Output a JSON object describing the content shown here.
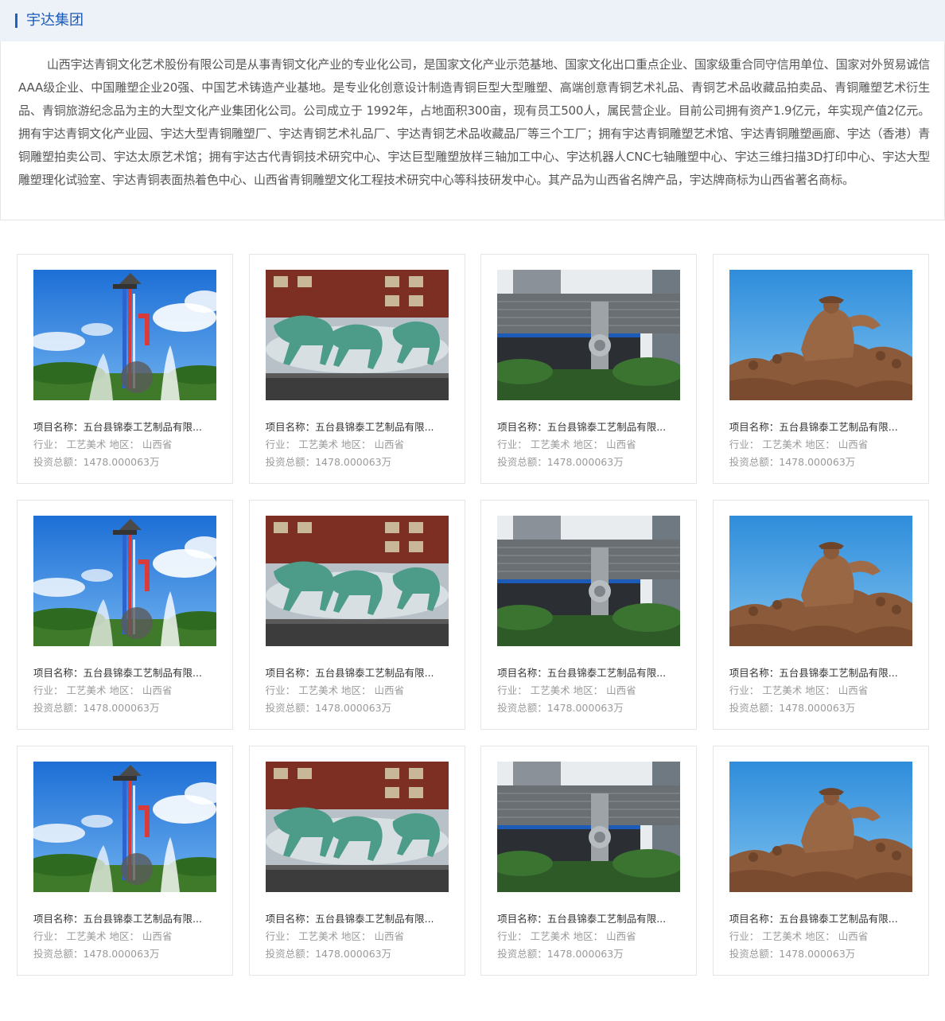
{
  "header": {
    "title": "宇达集团"
  },
  "intro": {
    "text": "山西宇达青铜文化艺术股份有限公司是从事青铜文化产业的专业化公司，是国家文化产业示范基地、国家文化出口重点企业、国家级重合同守信用单位、国家对外贸易诚信AAA级企业、中国雕塑企业20强、中国艺术铸造产业基地。是专业化创意设计制造青铜巨型大型雕塑、高端创意青铜艺术礼品、青铜艺术品收藏品拍卖品、青铜雕塑艺术衍生品、青铜旅游纪念品为主的大型文化产业集团化公司。公司成立于 1992年，占地面积300亩，现有员工500人，属民营企业。目前公司拥有资产1.9亿元，年实现产值2亿元。拥有宇达青铜文化产业园、宇达大型青铜雕塑厂、宇达青铜艺术礼品厂、宇达青铜艺术品收藏品厂等三个工厂；拥有宇达青铜雕塑艺术馆、宇达青铜雕塑画廊、宇达（香港）青铜雕塑拍卖公司、宇达太原艺术馆；拥有宇达古代青铜技术研究中心、宇达巨型雕塑放样三轴加工中心、宇达机器人CNC七轴雕塑中心、宇达三维扫描3D打印中心、宇达大型雕塑理化试验室、宇达青铜表面热着色中心、山西省青铜雕塑文化工程技术研究中心等科技研发中心。其产品为山西省名牌产品，宇达牌商标为山西省著名商标。"
  },
  "projects": [
    {
      "image": "tower-sculpture",
      "title": "项目名称：五台县锦泰工艺制品有限...",
      "meta": "行业： 工艺美术 地区： 山西省",
      "invest": "投资总额：1478.000063万"
    },
    {
      "image": "horse-fountain",
      "title": "项目名称：五台县锦泰工艺制品有限...",
      "meta": "行业： 工艺美术 地区： 山西省",
      "invest": "投资总额：1478.000063万"
    },
    {
      "image": "building-relief",
      "title": "项目名称：五台县锦泰工艺制品有限...",
      "meta": "行业： 工艺美术 地区： 山西省",
      "invest": "投资总额：1478.000063万"
    },
    {
      "image": "bronze-figures",
      "title": "项目名称：五台县锦泰工艺制品有限...",
      "meta": "行业： 工艺美术 地区： 山西省",
      "invest": "投资总额：1478.000063万"
    },
    {
      "image": "tower-sculpture",
      "title": "项目名称：五台县锦泰工艺制品有限...",
      "meta": "行业： 工艺美术 地区： 山西省",
      "invest": "投资总额：1478.000063万"
    },
    {
      "image": "horse-fountain",
      "title": "项目名称：五台县锦泰工艺制品有限...",
      "meta": "行业： 工艺美术 地区： 山西省",
      "invest": "投资总额：1478.000063万"
    },
    {
      "image": "building-relief",
      "title": "项目名称：五台县锦泰工艺制品有限...",
      "meta": "行业： 工艺美术 地区： 山西省",
      "invest": "投资总额：1478.000063万"
    },
    {
      "image": "bronze-figures",
      "title": "项目名称：五台县锦泰工艺制品有限...",
      "meta": "行业： 工艺美术 地区： 山西省",
      "invest": "投资总额：1478.000063万"
    },
    {
      "image": "tower-sculpture",
      "title": "项目名称：五台县锦泰工艺制品有限...",
      "meta": "行业： 工艺美术 地区： 山西省",
      "invest": "投资总额：1478.000063万"
    },
    {
      "image": "horse-fountain",
      "title": "项目名称：五台县锦泰工艺制品有限...",
      "meta": "行业： 工艺美术 地区： 山西省",
      "invest": "投资总额：1478.000063万"
    },
    {
      "image": "building-relief",
      "title": "项目名称：五台县锦泰工艺制品有限...",
      "meta": "行业： 工艺美术 地区： 山西省",
      "invest": "投资总额：1478.000063万"
    },
    {
      "image": "bronze-figures",
      "title": "项目名称：五台县锦泰工艺制品有限...",
      "meta": "行业： 工艺美术 地区： 山西省",
      "invest": "投资总额：1478.000063万"
    }
  ],
  "colors": {
    "accent": "#1c64c4",
    "header_bg": "#edf2f8",
    "muted_text": "#9a9a9a"
  }
}
